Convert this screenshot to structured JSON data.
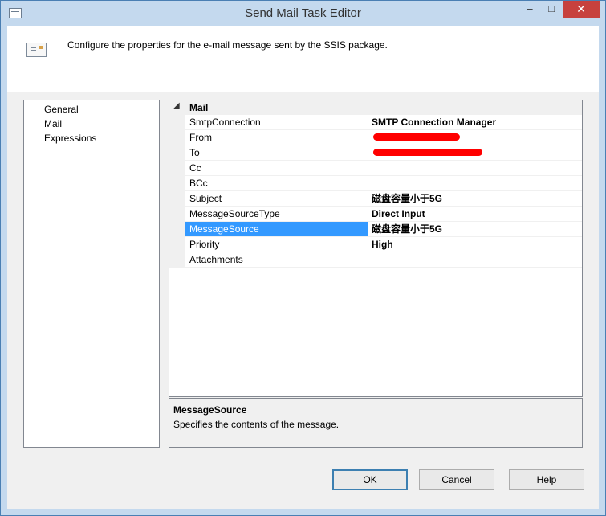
{
  "window": {
    "title": "Send Mail Task Editor",
    "minimize_glyph": "–",
    "maximize_glyph": "□",
    "close_glyph": "✕"
  },
  "header": {
    "description": "Configure the properties for the e-mail message sent by the SSIS package."
  },
  "nav": {
    "items": [
      {
        "label": "General"
      },
      {
        "label": "Mail"
      },
      {
        "label": "Expressions"
      }
    ]
  },
  "grid": {
    "category": {
      "label": "Mail",
      "toggle_glyph": "◢"
    },
    "rows": [
      {
        "name": "SmtpConnection",
        "value": "SMTP Connection Manager"
      },
      {
        "name": "From",
        "value": "",
        "redacted": true
      },
      {
        "name": "To",
        "value": "",
        "redacted": true
      },
      {
        "name": "Cc",
        "value": ""
      },
      {
        "name": "BCc",
        "value": ""
      },
      {
        "name": "Subject",
        "value": "磁盘容量小于5G"
      },
      {
        "name": "MessageSourceType",
        "value": "Direct Input"
      },
      {
        "name": "MessageSource",
        "value": "磁盘容量小于5G",
        "selected": true,
        "ellipsis": "..."
      },
      {
        "name": "Priority",
        "value": "High"
      },
      {
        "name": "Attachments",
        "value": ""
      }
    ]
  },
  "description_panel": {
    "title": "MessageSource",
    "text": "Specifies the contents of the message."
  },
  "buttons": {
    "ok": "OK",
    "cancel": "Cancel",
    "help": "Help"
  },
  "colors": {
    "selection": "#3399ff",
    "redaction": "#ff0000",
    "close_button": "#c7413d"
  }
}
